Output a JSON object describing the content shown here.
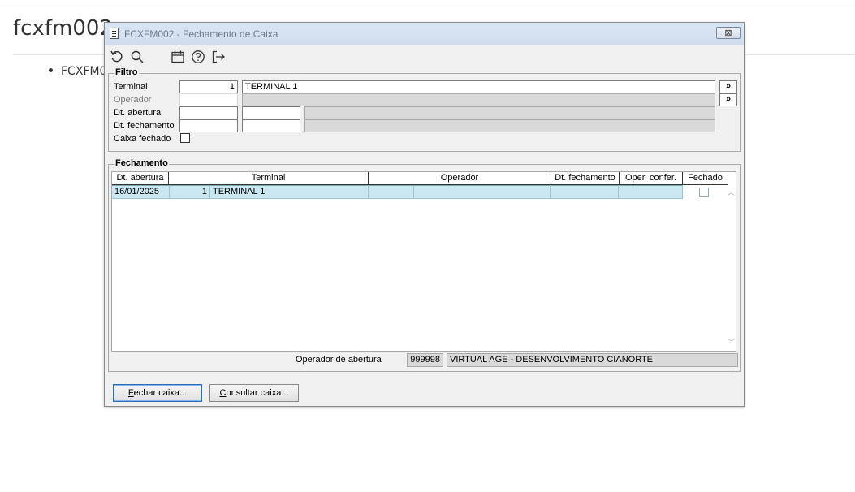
{
  "page": {
    "title": "fcxfm002",
    "bullet": "FCXFM002"
  },
  "window": {
    "title": "FCXFM002 - Fechamento de Caixa",
    "close_label": "⊠"
  },
  "toolbar": {
    "icons": [
      "undo-icon",
      "search-icon",
      "calendar-icon",
      "help-icon",
      "exit-icon"
    ]
  },
  "filtro": {
    "label": "Filtro",
    "terminal_label": "Terminal",
    "terminal_code": "1",
    "terminal_name": "TERMINAL 1",
    "operador_label": "Operador",
    "operador_code": "",
    "operador_name": "",
    "dt_abertura_label": "Dt. abertura",
    "dt_abertura_from": "",
    "dt_abertura_to": "",
    "dt_fechamento_label": "Dt. fechamento",
    "dt_fechamento_from": "",
    "dt_fechamento_to": "",
    "caixa_fechado_label": "Caixa fechado",
    "lookup_label": "»"
  },
  "fechamento": {
    "label": "Fechamento",
    "columns": [
      "Dt. abertura",
      "Terminal",
      "Operador",
      "Dt. fechamento",
      "Oper. confer.",
      "Fechado"
    ],
    "rows": [
      {
        "dt_abertura": "16/01/2025",
        "terminal_code": "1",
        "terminal_name": "TERMINAL 1",
        "operador_code": "",
        "operador_name": "",
        "dt_fechamento": "",
        "oper_confer": "",
        "fechado": false
      }
    ],
    "operador_abertura_label": "Operador de abertura",
    "operador_abertura_code": "999998",
    "operador_abertura_name": "VIRTUAL AGE - DESENVOLVIMENTO CIANORTE"
  },
  "buttons": {
    "fechar_first": "F",
    "fechar_rest": "echar caixa...",
    "consultar_first": "C",
    "consultar_rest": "onsultar caixa..."
  }
}
